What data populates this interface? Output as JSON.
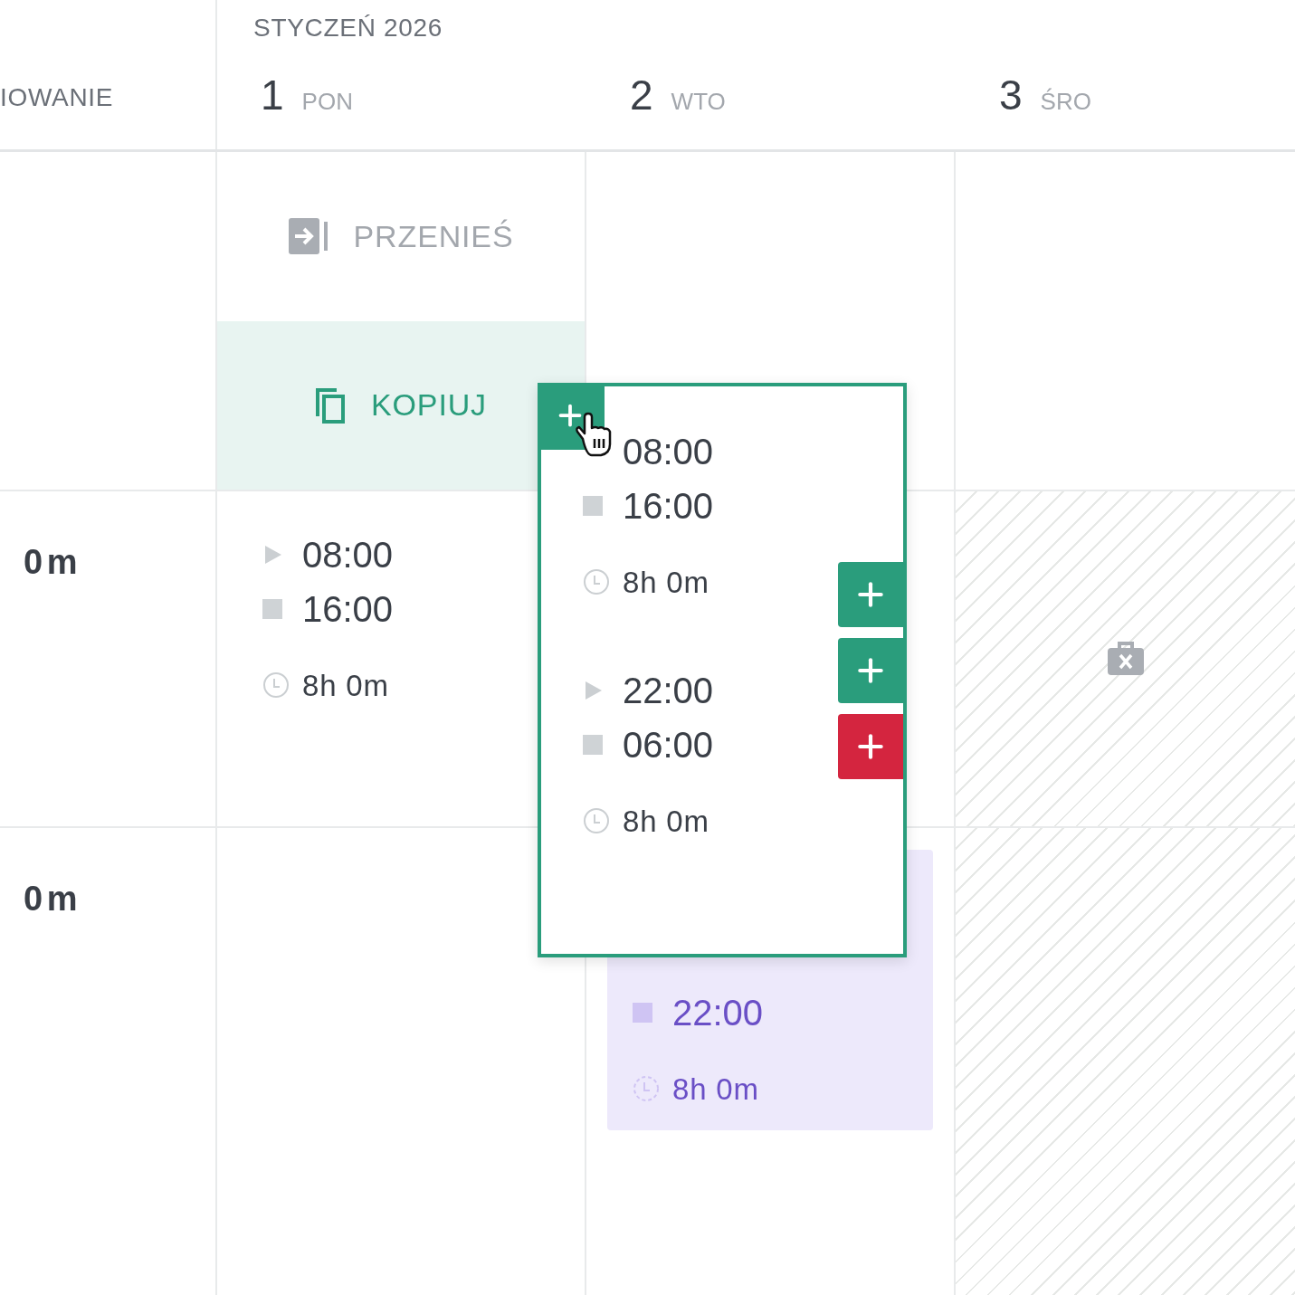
{
  "left_header": "IOWANIE",
  "month": "STYCZEŃ 2026",
  "days": [
    {
      "number": "1",
      "weekday": "PON"
    },
    {
      "number": "2",
      "weekday": "WTO"
    },
    {
      "number": "3",
      "weekday": "ŚRO"
    }
  ],
  "top_row": {
    "cells": [
      {
        "kind": "actions",
        "items": [
          {
            "kind": "move",
            "label": "PRZENIEŚ",
            "selected": false
          },
          {
            "kind": "copy",
            "label": "KOPIUJ",
            "selected": true
          }
        ]
      },
      {
        "kind": "empty"
      },
      {
        "kind": "empty"
      }
    ]
  },
  "rows": [
    {
      "total": "0m",
      "cells": [
        {
          "kind": "shift",
          "highlighted": false,
          "start": "08:00",
          "end": "16:00",
          "duration": "8h 0m"
        },
        {
          "kind": "empty"
        },
        {
          "kind": "unavailable"
        }
      ]
    },
    {
      "total": "0m",
      "cells": [
        {
          "kind": "empty"
        },
        {
          "kind": "shift",
          "highlighted": true,
          "end": "22:00",
          "duration": "8h 0m"
        },
        {
          "kind": "unavailable_plain"
        }
      ]
    }
  ],
  "popup": {
    "shifts": [
      {
        "start": "08:00",
        "start_icon": false,
        "end": "16:00",
        "duration": "8h 0m"
      },
      {
        "start": "22:00",
        "start_icon": true,
        "end": "06:00",
        "duration": "8h 0m"
      }
    ],
    "add_buttons": [
      {
        "color": "#2a9d7c"
      },
      {
        "color": "#2a9d7c"
      },
      {
        "color": "#d4253f"
      }
    ]
  }
}
